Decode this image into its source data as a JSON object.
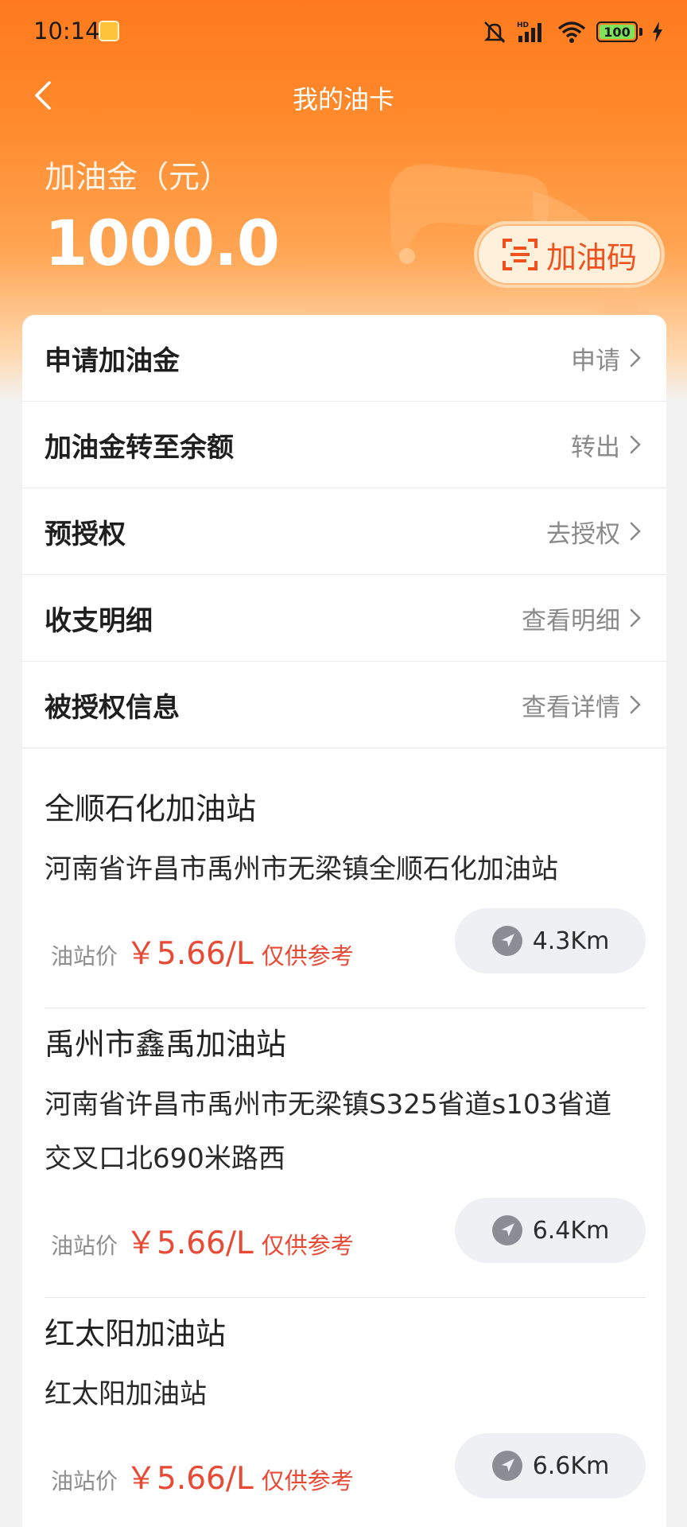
{
  "status_bar": {
    "time": "10:14",
    "battery": "100"
  },
  "nav": {
    "title": "我的油卡"
  },
  "fund": {
    "label": "加油金（元）",
    "amount": "1000.0",
    "code_button": "加油码"
  },
  "menu": [
    {
      "label": "申请加油金",
      "action": "申请"
    },
    {
      "label": "加油金转至余额",
      "action": "转出"
    },
    {
      "label": "预授权",
      "action": "去授权"
    },
    {
      "label": "收支明细",
      "action": "查看明细"
    },
    {
      "label": "被授权信息",
      "action": "查看详情"
    }
  ],
  "stations": [
    {
      "name": "全顺石化加油站",
      "address_lines": [
        "河南省许昌市禹州市无梁镇全顺石化加油站"
      ],
      "price_label": "油站价",
      "price": "￥5.66/L",
      "price_note": "仅供参考",
      "distance": "4.3Km"
    },
    {
      "name": "禹州市鑫禹加油站",
      "address_lines": [
        "河南省许昌市禹州市无梁镇S325省道s103省道",
        "交叉口北690米路西"
      ],
      "price_label": "油站价",
      "price": "￥5.66/L",
      "price_note": "仅供参考",
      "distance": "6.4Km"
    },
    {
      "name": "红太阳加油站",
      "address_lines": [
        "红太阳加油站"
      ],
      "price_label": "油站价",
      "price": "￥5.66/L",
      "price_note": "仅供参考",
      "distance": "6.6Km"
    }
  ],
  "colors": {
    "brand_orange": "#ff7a1e",
    "price_red": "#e84a36"
  }
}
